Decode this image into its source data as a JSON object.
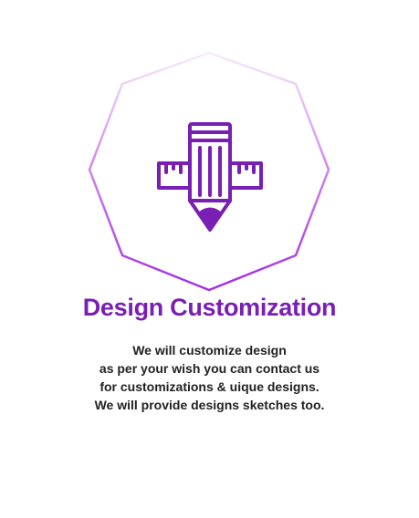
{
  "card": {
    "icon": "pencil-ruler-icon",
    "title": "Design Customization",
    "description_lines": [
      "We will customize design",
      "as per your wish you can contact us",
      "for customizations & uique designs.",
      "We will provide designs sketches too."
    ]
  },
  "colors": {
    "accent": "#7a1fb3",
    "frame_light": "#f3e6fb",
    "frame_dark": "#a42ee0",
    "text": "#222222",
    "background": "#ffffff"
  }
}
